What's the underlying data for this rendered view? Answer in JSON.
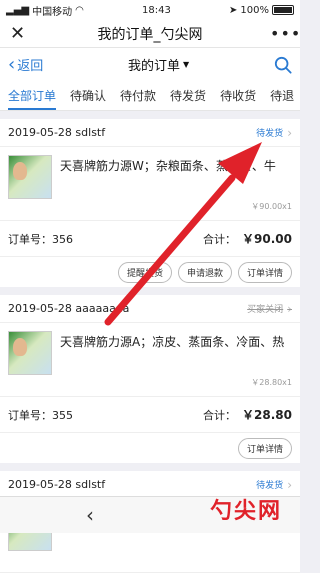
{
  "status_bar": {
    "carrier": "中国移动",
    "time": "18:43",
    "battery": "100%"
  },
  "window": {
    "title": "我的订单_勺尖网"
  },
  "nav": {
    "back_label": "返回",
    "title": "我的订单"
  },
  "tabs": [
    {
      "label": "全部订单"
    },
    {
      "label": "待确认"
    },
    {
      "label": "待付款"
    },
    {
      "label": "待发货"
    },
    {
      "label": "待收货"
    },
    {
      "label": "待退"
    }
  ],
  "orders": [
    {
      "date_user": "2019-05-28 sdlstf",
      "status": "待发货",
      "product_name": "天喜牌筋力源W；杂粮面条、蒸面条、牛",
      "product_price": "￥90.00x1",
      "order_no": "订单号：356",
      "total_label": "合计：",
      "total_value": "￥90.00",
      "actions": [
        "提醒发货",
        "申请退款",
        "订单详情"
      ]
    },
    {
      "date_user": "2019-05-28 aaaaaaaa",
      "status": "买家关闭",
      "product_name": "天喜牌筋力源A；凉皮、蒸面条、冷面、热",
      "product_price": "￥28.80x1",
      "order_no": "订单号：355",
      "total_label": "合计：",
      "total_value": "￥28.80",
      "actions": [
        "订单详情"
      ]
    },
    {
      "date_user": "2019-05-28 sdlstf",
      "status": "待发货"
    }
  ],
  "watermark": "勺尖网",
  "colors": {
    "accent": "#2a7ad2",
    "arrow": "#e0222a"
  }
}
